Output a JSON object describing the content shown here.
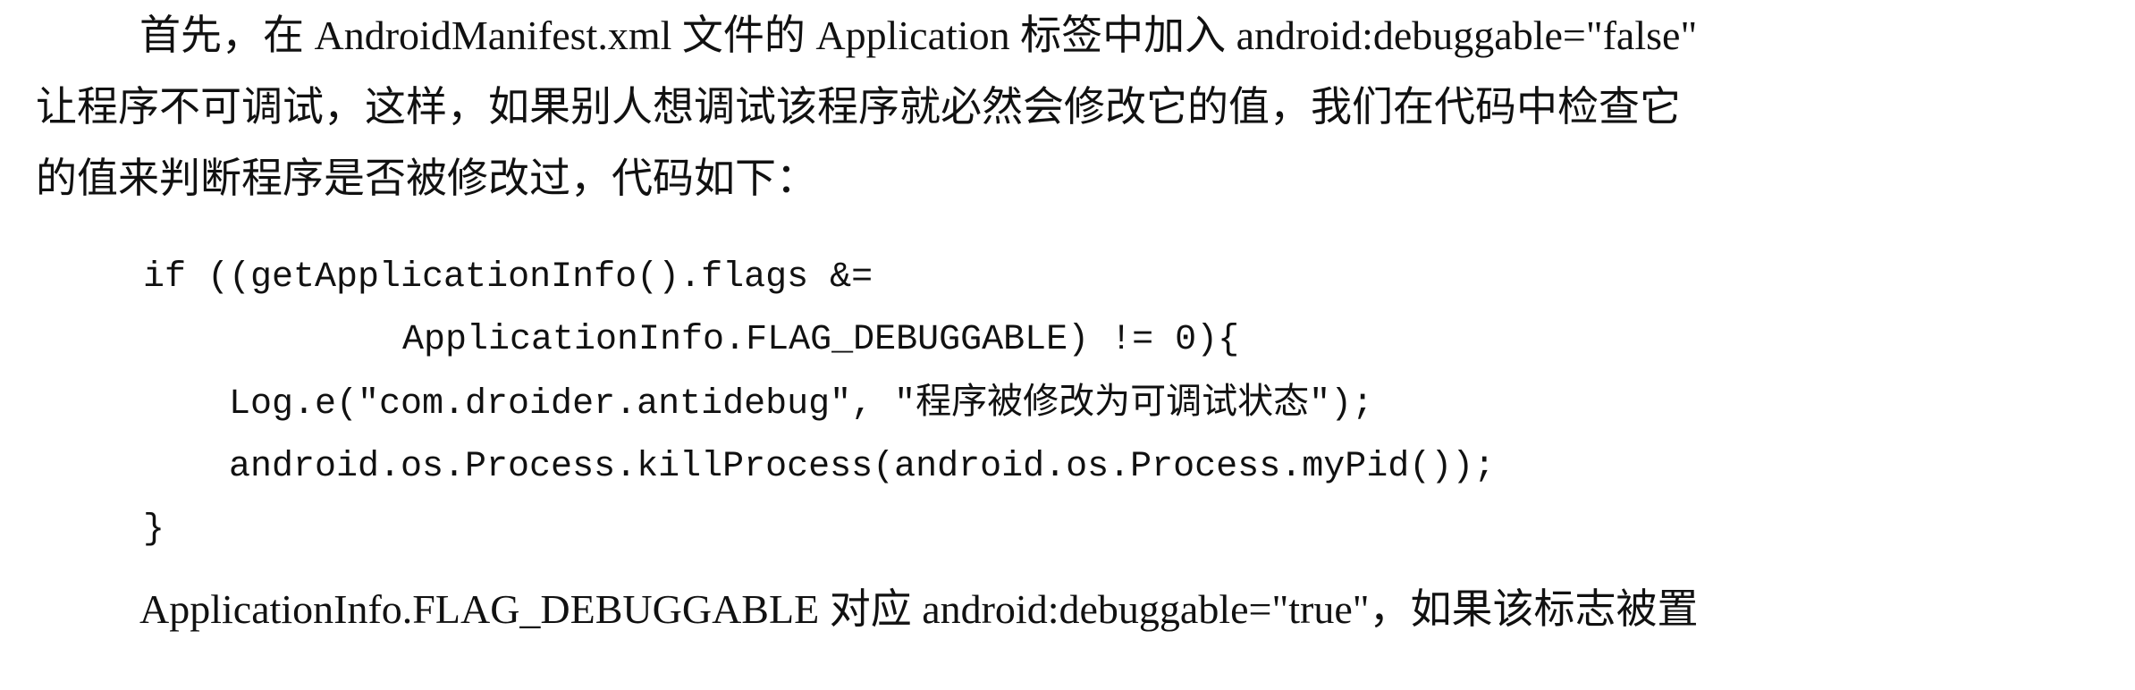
{
  "paragraph_1": {
    "line_1": "首先，在 AndroidManifest.xml 文件的 Application 标签中加入 android:debuggable=\"false\"",
    "line_2": "让程序不可调试，这样，如果别人想调试该程序就必然会修改它的值，我们在代码中检查它",
    "line_3": "的值来判断程序是否被修改过，代码如下："
  },
  "code_block": {
    "line_1": "if ((getApplicationInfo().flags &=",
    "line_2": "ApplicationInfo.FLAG_DEBUGGABLE) != 0){",
    "line_3": "Log.e(\"com.droider.antidebug\", \"程序被修改为可调试状态\");",
    "line_4": "android.os.Process.killProcess(android.os.Process.myPid());",
    "line_5": "}"
  },
  "paragraph_2": {
    "line_1": "ApplicationInfo.FLAG_DEBUGGABLE 对应 android:debuggable=\"true\"，如果该标志被置"
  }
}
